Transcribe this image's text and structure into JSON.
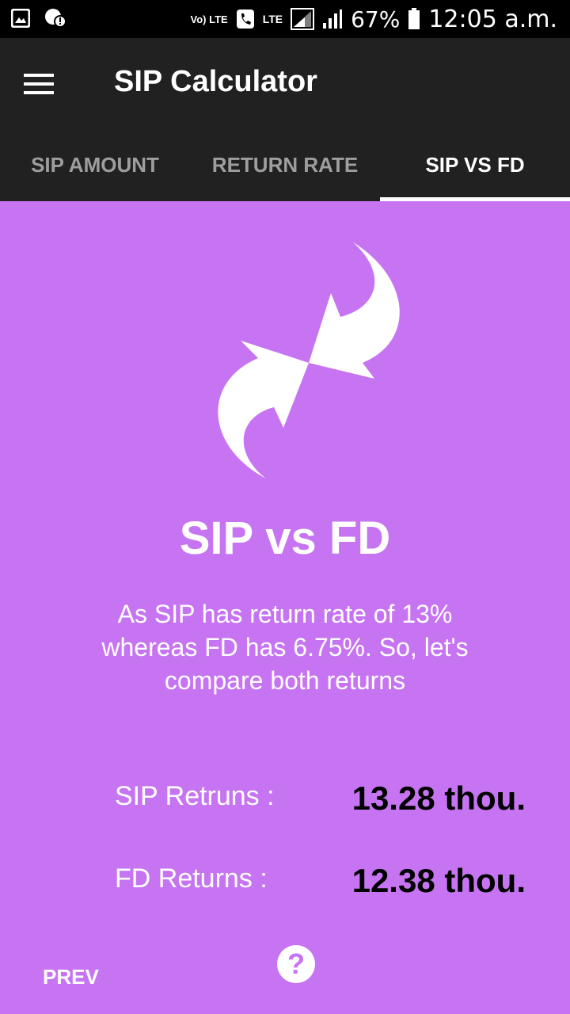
{
  "status_bar": {
    "volte": "Vo) LTE",
    "lte": "LTE",
    "battery": "67%",
    "time": "12:05 a.m."
  },
  "app_bar": {
    "title": "SIP Calculator"
  },
  "tabs": [
    {
      "label": "SIP AMOUNT",
      "active": false
    },
    {
      "label": "RETURN RATE",
      "active": false
    },
    {
      "label": "SIP VS FD",
      "active": true
    }
  ],
  "content": {
    "icon": "exchange-arrows-icon",
    "heading": "SIP vs FD",
    "description": "As SIP has return rate of 13% whereas FD has 6.75%. So, let's compare both returns",
    "rows": [
      {
        "label": "SIP Retruns :",
        "value": "13.28 thou."
      },
      {
        "label": "FD Returns :",
        "value": "12.38 thou."
      }
    ]
  },
  "footer": {
    "prev_label": "PREV",
    "help_icon": "?"
  },
  "colors": {
    "background": "#c774f2",
    "app_bar": "#212121",
    "status_bar": "#000000",
    "value_text": "#000000"
  }
}
